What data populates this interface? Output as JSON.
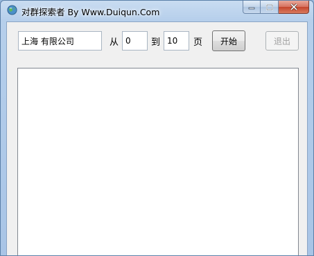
{
  "window": {
    "title": "对群探索者 By Www.Duiqun.Com"
  },
  "form": {
    "keyword_value": "上海 有限公司",
    "from_label": "从",
    "from_value": "0",
    "to_label": "到",
    "to_value": "10",
    "page_label": "页",
    "start_label": "开始",
    "exit_label": "退出"
  },
  "output": {
    "text": ""
  },
  "icons": {
    "app": "globe-icon",
    "minimize": "minimize-icon",
    "maximize": "maximize-icon",
    "close": "close-icon"
  },
  "colors": {
    "titlebar": "#b6cfeb",
    "close_button": "#c4452c",
    "client": "#f0f0f0"
  }
}
